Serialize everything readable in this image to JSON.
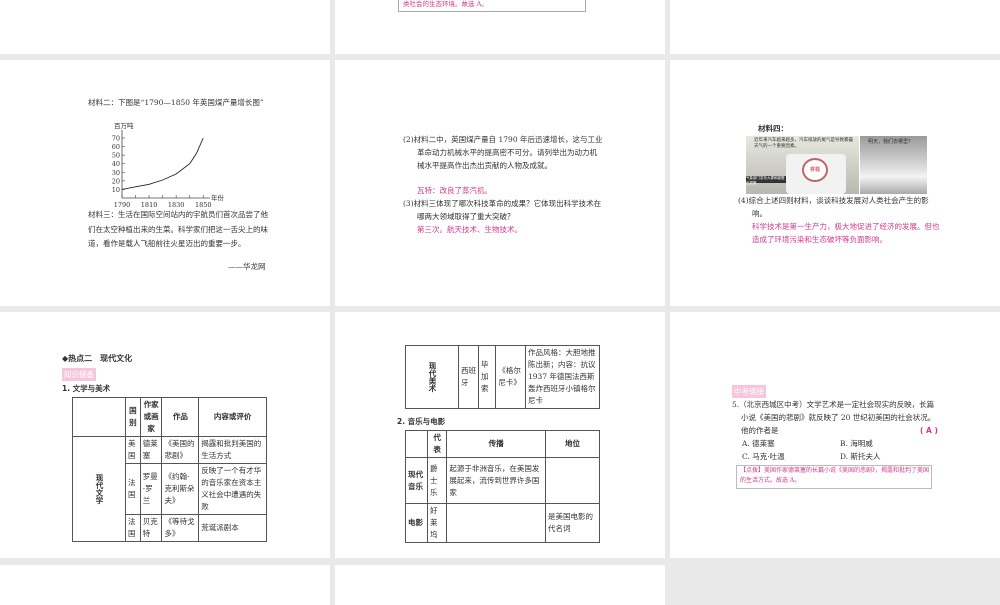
{
  "top_middle": {
    "note_text": "类社会的生态环境。故选 A。"
  },
  "p4": {
    "material2_intro": "材料二：下图是“1790—1850 年英国煤产量增长图”",
    "material3": "材料三：生活在国际空间站内的宇航员们首次品尝了他们在太空种植出来的生菜。科学家们把这一舌尖上的味道，看作是载人飞船前往火星迈出的重要一步。",
    "source": "——华龙网"
  },
  "chart_data": {
    "type": "line",
    "title": "1790—1850 年英国煤产量增长图",
    "xlabel": "年份",
    "ylabel": "百万吨",
    "x": [
      1790,
      1800,
      1810,
      1820,
      1830,
      1840,
      1845,
      1850
    ],
    "values": [
      10,
      13,
      16,
      21,
      28,
      40,
      52,
      70
    ],
    "xticks": [
      "1790",
      "1810",
      "1830",
      "1850"
    ],
    "yticks": [
      "10",
      "20",
      "30",
      "40",
      "50",
      "60",
      "70"
    ],
    "xlim": [
      1790,
      1855
    ],
    "ylim": [
      0,
      70
    ],
    "grid": false
  },
  "p5": {
    "q2": "(2)材料二中，英国煤产量自 1790 年后迅速增长，这与工业革命动力机械水平的提高密不可分。请列举出为动力机械水平提高作出杰出贡献的人物及成就。",
    "a2": "瓦特：改良了蒸汽机。",
    "q3": "(3)材料三体现了哪次科技革命的成果？它体现出科学技术在哪两大领域取得了重大突破？",
    "a3": "第三次。航天技术、生物技术。"
  },
  "p6": {
    "material4": "材料四：",
    "img1_text": "近年来汽车越来越多，汽车排放的尾气是导致雾霾天气的一个重要因素。",
    "img1_caption": "气象部门发布大雾和霾橙色预警",
    "img2_text": "雾霾",
    "img3_text": "明天，我们去哪里？",
    "q4": "(4)综合上述四则材料，谈谈科技发展对人类社会产生的影响。",
    "a4": "科学技术是第一生产力，极大地促进了经济的发展。但也造成了环境污染和生态破坏等负面影响。"
  },
  "p7": {
    "heading": "◆热点二　现代文化",
    "tag": "知识储备",
    "sub1": "1. 文学与美术",
    "headers": [
      "国别",
      "作家或画家",
      "作品",
      "内容或评价"
    ],
    "group": "现代文学",
    "rows": [
      [
        "美国",
        "德莱塞",
        "《美国的悲剧》",
        "揭露和批判美国的生活方式"
      ],
      [
        "法国",
        "罗曼·罗兰",
        "《约翰·克利斯朵夫》",
        "反映了一个有才华的音乐家在资本主义社会中遭遇的失败"
      ],
      [
        "法国",
        "贝克特",
        "《等待戈多》",
        "荒诞派剧本"
      ]
    ]
  },
  "p8": {
    "group": "现代美术",
    "row": [
      "西班牙",
      "毕加索",
      "《格尔尼卡》",
      "作品风格：大胆地推陈出新；内容：抗议 1937 年德国法西斯轰炸西班牙小镇格尔尼卡"
    ],
    "sub2": "2. 音乐与电影",
    "headers": [
      "",
      "代表",
      "传播",
      "地位"
    ],
    "rows": [
      [
        "现代音乐",
        "爵士乐",
        "起源于非洲音乐，在美国发展起来，流传到世界许多国家",
        ""
      ],
      [
        "电影",
        "好莱坞",
        "",
        "是美国电影的代名词"
      ]
    ]
  },
  "p9": {
    "tag": "中考链接",
    "question": "5.（北京西城区中考）文学艺术是一定社会现实的反映，长篇小说《美国的悲剧》就反映了 20 世纪初美国的社会状况。他的作者是",
    "answer": "A",
    "options": [
      "A. 德莱塞",
      "B. 海明威",
      "C. 马克·吐温",
      "D. 斯托夫人"
    ],
    "note": "【点拨】美国作家德莱塞的长篇小说《美国的悲剧》，揭露和批判了美国的生活方式。故选 A。"
  }
}
